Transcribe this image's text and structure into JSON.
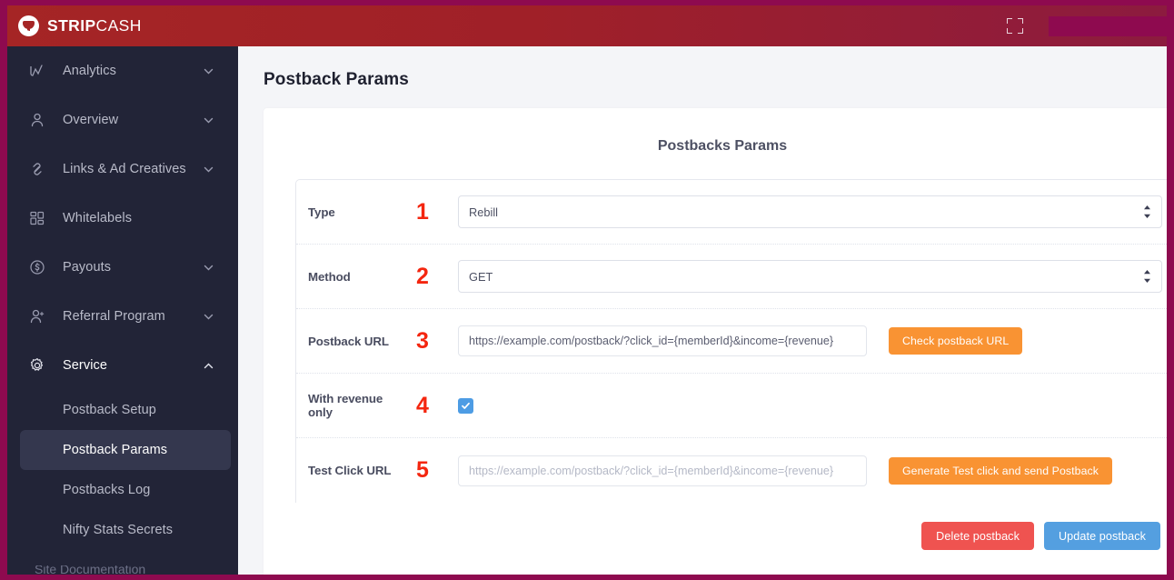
{
  "brand": {
    "bold": "STRIP",
    "light": "CASH",
    "logo_icon": "speech-bubble-logo"
  },
  "topbar": {
    "fullscreen_icon": "fullscreen-expand-icon"
  },
  "sidebar": {
    "items": [
      {
        "label": "Analytics",
        "icon": "analytics-chart-icon",
        "chevron": "chevron-down-icon"
      },
      {
        "label": "Overview",
        "icon": "user-icon",
        "chevron": "chevron-down-icon"
      },
      {
        "label": "Links & Ad Creatives",
        "icon": "link-chain-icon",
        "chevron": "chevron-down-icon"
      },
      {
        "label": "Whitelabels",
        "icon": "grid-blocks-icon",
        "chevron": ""
      },
      {
        "label": "Payouts",
        "icon": "dollar-circle-icon",
        "chevron": "chevron-down-icon"
      },
      {
        "label": "Referral Program",
        "icon": "user-plus-icon",
        "chevron": "chevron-down-icon"
      },
      {
        "label": "Service",
        "icon": "gear-icon",
        "chevron": "chevron-up-icon"
      }
    ],
    "sub_items": [
      {
        "label": "Postback Setup",
        "selected": false
      },
      {
        "label": "Postback Params",
        "selected": true
      },
      {
        "label": "Postbacks Log",
        "selected": false
      },
      {
        "label": "Nifty Stats Secrets",
        "selected": false
      }
    ],
    "footer_text": "Site Documentation"
  },
  "main": {
    "page_title": "Postback Params",
    "card_title": "Postbacks Params",
    "rows": {
      "type": {
        "label": "Type",
        "marker": "1",
        "value": "Rebill",
        "options": [
          "Rebill"
        ]
      },
      "method": {
        "label": "Method",
        "marker": "2",
        "value": "GET",
        "options": [
          "GET"
        ]
      },
      "postback_url": {
        "label": "Postback URL",
        "marker": "3",
        "value": "https://example.com/postback/?click_id={memberId}&income={revenue}",
        "placeholder": "https://example.com/postback/?click_id={memberId}&income={revenue}",
        "button": "Check postback URL"
      },
      "with_revenue_only": {
        "label": "With revenue only",
        "marker": "4",
        "checked": true,
        "check_icon": "checkmark-icon"
      },
      "test_click_url": {
        "label": "Test Click URL",
        "marker": "5",
        "value": "",
        "placeholder": "https://example.com/postback/?click_id={memberId}&income={revenue}",
        "button": "Generate Test click and send Postback"
      }
    },
    "actions": {
      "delete": "Delete postback",
      "update": "Update postback"
    }
  },
  "colors": {
    "brand_red": "#a52525",
    "frame_magenta": "#8e0a4f",
    "sidebar_dark": "#222437",
    "accent_orange": "#f99333",
    "danger_red": "#ef5350",
    "primary_blue": "#549fe0",
    "checkbox_blue": "#4d9ce4",
    "marker_red": "#f4260f"
  }
}
